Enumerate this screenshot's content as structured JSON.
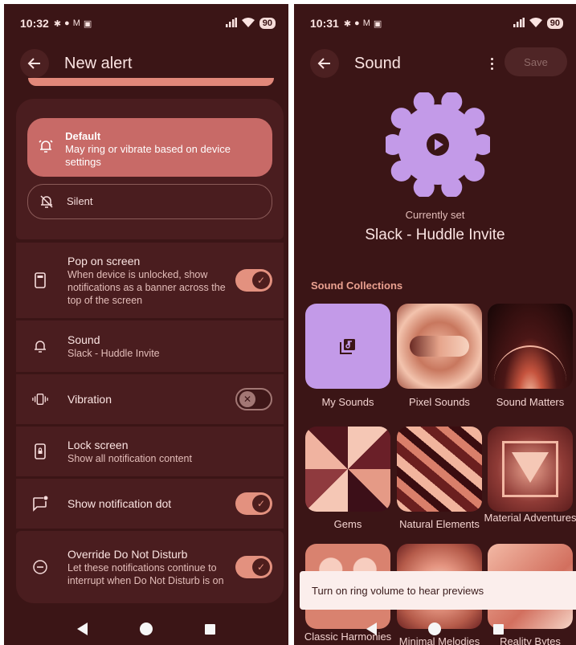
{
  "left": {
    "status": {
      "time": "10:32",
      "battery": "90"
    },
    "title": "New alert",
    "importance": {
      "default": {
        "title": "Default",
        "subtitle": "May ring or vibrate based on device settings"
      },
      "silent": {
        "title": "Silent"
      }
    },
    "rows": {
      "pop": {
        "title": "Pop on screen",
        "subtitle": "When device is unlocked, show notifications as a banner across the top of the screen"
      },
      "sound": {
        "title": "Sound",
        "subtitle": "Slack - Huddle Invite"
      },
      "vibration": {
        "title": "Vibration"
      },
      "lock": {
        "title": "Lock screen",
        "subtitle": "Show all notification content"
      },
      "dot": {
        "title": "Show notification dot"
      },
      "dnd": {
        "title": "Override Do Not Disturb",
        "subtitle": "Let these notifications continue to interrupt when Do Not Disturb is on"
      }
    },
    "toggles": {
      "pop_on_screen": true,
      "vibration": false,
      "notification_dot": true,
      "override_dnd": true
    }
  },
  "right": {
    "status": {
      "time": "10:31",
      "battery": "90"
    },
    "title": "Sound",
    "save_label": "Save",
    "currently_set_label": "Currently set",
    "current_sound": "Slack - Huddle Invite",
    "collections_heading": "Sound Collections",
    "collections": [
      "My Sounds",
      "Pixel Sounds",
      "Sound Matters",
      "Gems",
      "Natural Elements",
      "Material Adventures",
      "Classic Harmonies",
      "Minimal Melodies",
      "Reality Bytes"
    ],
    "snackbar": "Turn on ring volume to hear previews"
  },
  "icons": [
    "back-arrow-icon",
    "more-vert-icon",
    "play-icon",
    "bell-ring-icon",
    "bell-off-icon",
    "phone-icon",
    "bell-icon",
    "vibration-icon",
    "lock-screen-icon",
    "notification-dot-icon",
    "dnd-icon",
    "library-music-icon"
  ],
  "colors": {
    "background": "#3b1516",
    "card": "#4a1d1f",
    "accent": "#e3917f",
    "selected": "#c86a67",
    "blob": "#c39ae8"
  }
}
